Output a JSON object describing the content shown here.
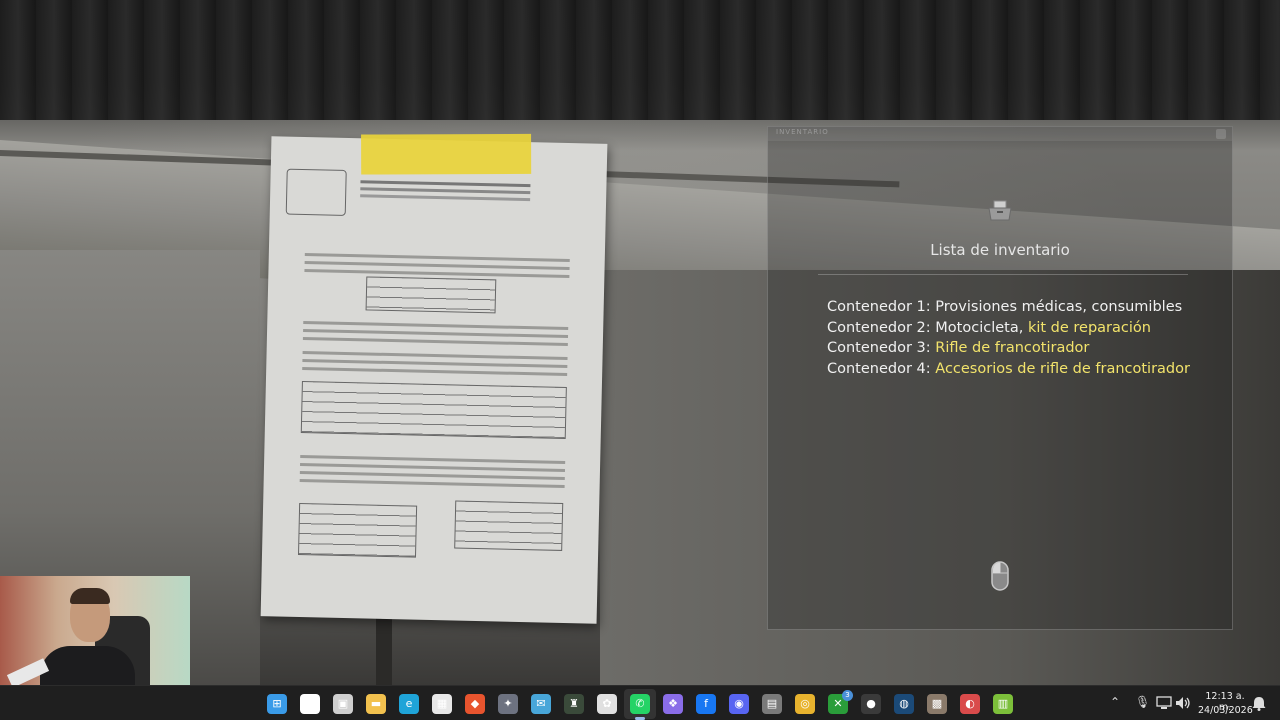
{
  "inventory": {
    "topbar_text": "INVENTARIO",
    "title": "Lista de inventario",
    "items": [
      {
        "prefix": "Contenedor 1: ",
        "plain": "Provisiones médicas, consumibles",
        "highlight": ""
      },
      {
        "prefix": "Contenedor 2: ",
        "plain": "Motocicleta, ",
        "highlight": "kit de reparación"
      },
      {
        "prefix": "Contenedor 3: ",
        "plain": "",
        "highlight": "Rifle de francotirador"
      },
      {
        "prefix": "Contenedor 4: ",
        "plain": "",
        "highlight": "Accesorios de rifle de francotirador"
      }
    ],
    "highlight_color": "#f2e36b",
    "icons": {
      "top": "folder-icon",
      "bottom": "mouse-icon"
    }
  },
  "taskbar": {
    "apps": [
      {
        "name": "windows-start-icon",
        "glyph": "⊞",
        "color": "#3a9be8"
      },
      {
        "name": "search-icon",
        "glyph": "⌕",
        "color": "#ffffff"
      },
      {
        "name": "task-view-icon",
        "glyph": "▣",
        "color": "#cfcfcf"
      },
      {
        "name": "file-explorer-icon",
        "glyph": "▬",
        "color": "#f2c14e"
      },
      {
        "name": "edge-icon",
        "glyph": "e",
        "color": "#1fa4d8"
      },
      {
        "name": "store-icon",
        "glyph": "▦",
        "color": "#e8e8e8"
      },
      {
        "name": "brave-icon",
        "glyph": "◆",
        "color": "#e8542e"
      },
      {
        "name": "game-app-icon",
        "glyph": "✦",
        "color": "#6d7280"
      },
      {
        "name": "mail-app-icon",
        "glyph": "✉",
        "color": "#48a6d9"
      },
      {
        "name": "game-app-2-icon",
        "glyph": "♜",
        "color": "#3a4a3a"
      },
      {
        "name": "chatgpt-icon",
        "glyph": "✿",
        "color": "#e0e0e0"
      },
      {
        "name": "whatsapp-icon",
        "glyph": "✆",
        "color": "#25d366"
      },
      {
        "name": "copilot-icon",
        "glyph": "❖",
        "color": "#8a6de8"
      },
      {
        "name": "facebook-icon",
        "glyph": "f",
        "color": "#1877f2"
      },
      {
        "name": "discord-icon",
        "glyph": "◉",
        "color": "#5865f2"
      },
      {
        "name": "calculator-icon",
        "glyph": "▤",
        "color": "#7a7a7a"
      },
      {
        "name": "chrome-icon",
        "glyph": "◎",
        "color": "#e8b32e"
      },
      {
        "name": "xbox-icon",
        "glyph": "✕",
        "color": "#2a9d3a",
        "badge": "3"
      },
      {
        "name": "tray-app-icon",
        "glyph": "●",
        "color": "#3a3a3a"
      },
      {
        "name": "steam-icon",
        "glyph": "◍",
        "color": "#1b4a78"
      },
      {
        "name": "game-app-3-icon",
        "glyph": "▩",
        "color": "#8a7a6a"
      },
      {
        "name": "overlay-app-icon",
        "glyph": "◐",
        "color": "#d94b4b"
      },
      {
        "name": "android-app-icon",
        "glyph": "▥",
        "color": "#7cbf3a"
      }
    ],
    "active_app": "whatsapp-icon",
    "tray_icons": [
      "chevron-up-icon",
      "microphone-icon",
      "network-icon",
      "volume-icon"
    ],
    "clock": {
      "time": "12:13 a. m.",
      "date": "24/03/2026"
    },
    "notification_icon": "notification-bell-icon"
  }
}
